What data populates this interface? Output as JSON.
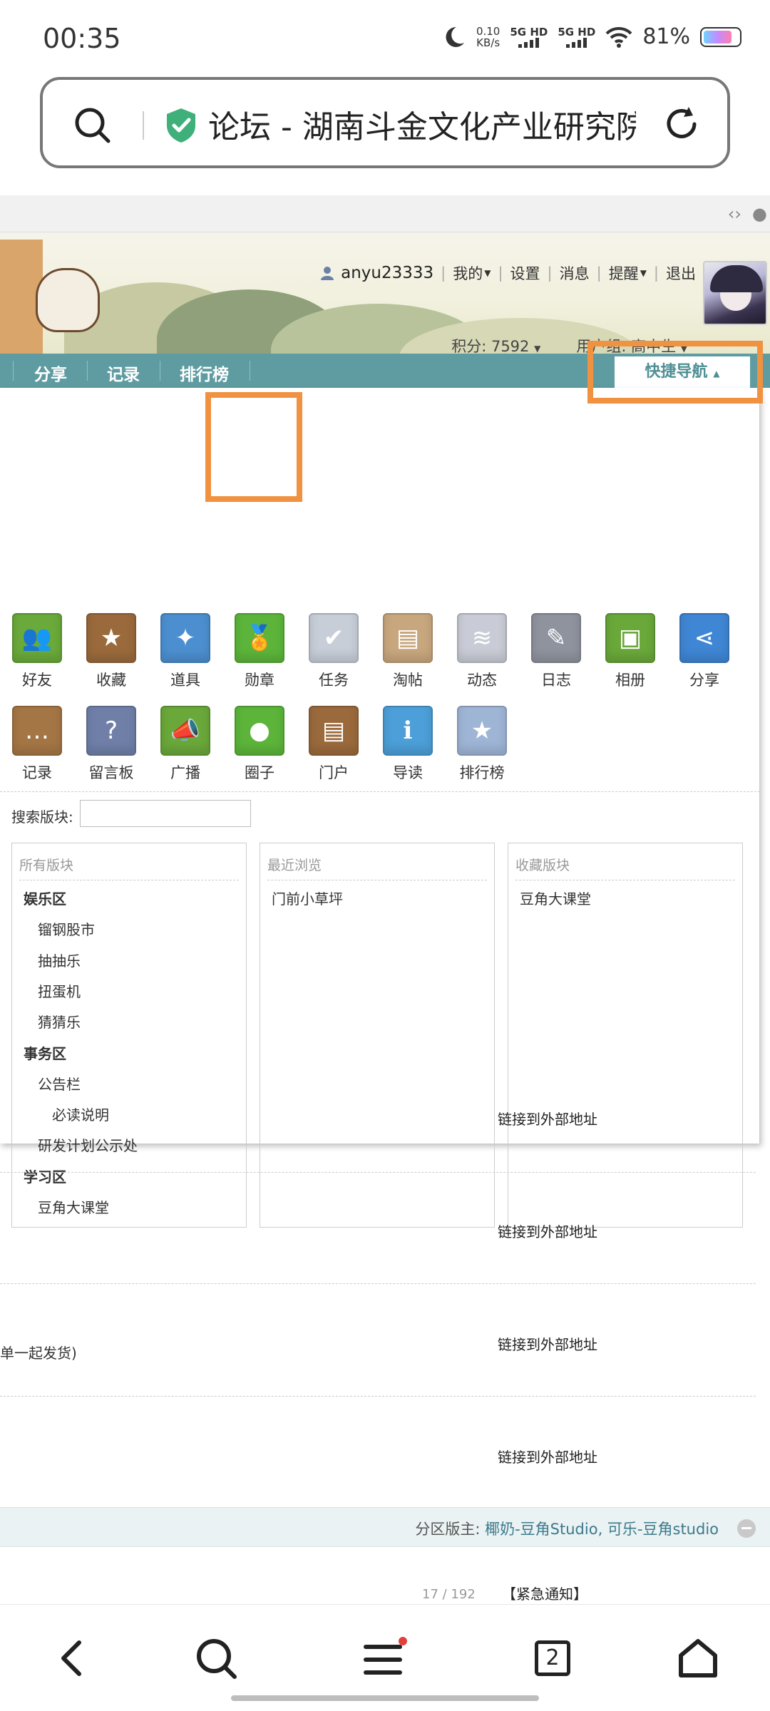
{
  "status_bar": {
    "time": "00:35",
    "net_speed_value": "0.10",
    "net_speed_unit": "KB/s",
    "sim1": "5G HD",
    "sim2": "5G HD",
    "battery": "81%"
  },
  "address_bar": {
    "url_title": "论坛 - 湖南斗金文化产业研究院"
  },
  "header": {
    "username": "anyu23333",
    "links": [
      "我的",
      "设置",
      "消息",
      "提醒",
      "退出"
    ],
    "score": "积分: 7592",
    "user_group": "用户组: 高中生"
  },
  "navbar": {
    "items": [
      "分享",
      "记录",
      "排行榜"
    ],
    "quick_nav": "快捷导航"
  },
  "quick_panel": {
    "apps_row1": [
      {
        "label": "好友",
        "icon": "friends-icon",
        "color": "#6aaa3a"
      },
      {
        "label": "收藏",
        "icon": "star-icon",
        "color": "#9a6a3c"
      },
      {
        "label": "道具",
        "icon": "wand-icon",
        "color": "#4c8fd0"
      },
      {
        "label": "勋章",
        "icon": "medal-icon",
        "color": "#5cb53a"
      },
      {
        "label": "任务",
        "icon": "task-icon",
        "color": "#c7ced8"
      },
      {
        "label": "淘帖",
        "icon": "tray-icon",
        "color": "#c8a77e"
      },
      {
        "label": "动态",
        "icon": "rss-icon",
        "color": "#c9ccd6"
      },
      {
        "label": "日志",
        "icon": "journal-icon",
        "color": "#8f939e"
      },
      {
        "label": "相册",
        "icon": "album-icon",
        "color": "#6aa83a"
      },
      {
        "label": "分享",
        "icon": "share-icon",
        "color": "#3f86d4"
      }
    ],
    "apps_row2": [
      {
        "label": "记录",
        "icon": "chat-bubble-icon",
        "color": "#a57645"
      },
      {
        "label": "留言板",
        "icon": "question-book-icon",
        "color": "#6f7fa8"
      },
      {
        "label": "广播",
        "icon": "megaphone-icon",
        "color": "#6aa83a"
      },
      {
        "label": "圈子",
        "icon": "group-icon",
        "color": "#5cb53a"
      },
      {
        "label": "门户",
        "icon": "newspaper-icon",
        "color": "#9a6a3c"
      },
      {
        "label": "导读",
        "icon": "guide-icon",
        "color": "#4c9fd8"
      },
      {
        "label": "排行榜",
        "icon": "rank-badge-icon",
        "color": "#9fb5d6"
      }
    ],
    "search_label": "搜索版块:",
    "columns": [
      {
        "title": "所有版块",
        "items": [
          {
            "label": "娱乐区",
            "level": 0
          },
          {
            "label": "镏钢股市",
            "level": 1
          },
          {
            "label": "抽抽乐",
            "level": 1
          },
          {
            "label": "扭蛋机",
            "level": 1
          },
          {
            "label": "猜猜乐",
            "level": 1
          },
          {
            "label": "事务区",
            "level": 0
          },
          {
            "label": "公告栏",
            "level": 1
          },
          {
            "label": "必读说明",
            "level": 2
          },
          {
            "label": "研发计划公示处",
            "level": 1
          },
          {
            "label": "学习区",
            "level": 0
          },
          {
            "label": "豆角大课堂",
            "level": 1
          }
        ]
      },
      {
        "title": "最近浏览",
        "items": [
          {
            "label": "门前小草坪",
            "level": 0
          }
        ]
      },
      {
        "title": "收藏版块",
        "items": [
          {
            "label": "豆角大课堂",
            "level": 0
          }
        ]
      }
    ]
  },
  "forum": {
    "external_link": "链接到外部地址",
    "partial_text": "单一起发货)",
    "moderator_label": "分区版主: ",
    "moderators": "椰奶-豆角Studio, 可乐-豆角studio",
    "notice": "【紧急通知】",
    "counter": "17 / 192"
  },
  "bottom_bar": {
    "tab_count": "2"
  }
}
